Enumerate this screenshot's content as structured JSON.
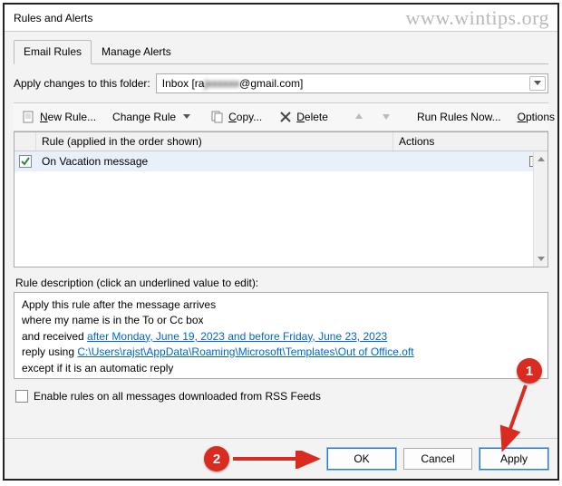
{
  "window": {
    "title": "Rules and Alerts"
  },
  "watermark": "www.wintips.org",
  "tabs": {
    "email_rules": "Email Rules",
    "manage_alerts": "Manage Alerts"
  },
  "folder": {
    "label": "Apply changes to this folder:",
    "value_prefix": "Inbox [ra",
    "value_obscured": "jxxxxxx",
    "value_suffix": "@gmail.com]"
  },
  "toolbar": {
    "new_rule_pre": "N",
    "new_rule_post": "ew Rule...",
    "change_rule": "Change Rule",
    "copy_pre": "C",
    "copy_post": "opy...",
    "delete_pre": "D",
    "delete_post": "elete",
    "run_now": "Run Rules Now...",
    "options_pre": "O",
    "options_post": "ptions"
  },
  "list": {
    "header_rule": "Rule (applied in the order shown)",
    "header_actions": "Actions",
    "rows": [
      {
        "name": "On Vacation message",
        "checked": true
      }
    ]
  },
  "description": {
    "label": "Rule description (click an underlined value to edit):",
    "line1": "Apply this rule after the message arrives",
    "line2": "where my name is in the To or Cc box",
    "line3_prefix": "  and received ",
    "line3_link": "after Monday, June 19, 2023 and before Friday, June 23, 2023",
    "line4_prefix": "reply using ",
    "line4_link": "C:\\Users\\rajst\\AppData\\Roaming\\Microsoft\\Templates\\Out of Office.oft",
    "line5": "except if it is an automatic reply"
  },
  "rss": {
    "label": "Enable rules on all messages downloaded from RSS Feeds"
  },
  "buttons": {
    "ok": "OK",
    "cancel": "Cancel",
    "apply": "Apply"
  },
  "annotations": {
    "one": "1",
    "two": "2"
  }
}
